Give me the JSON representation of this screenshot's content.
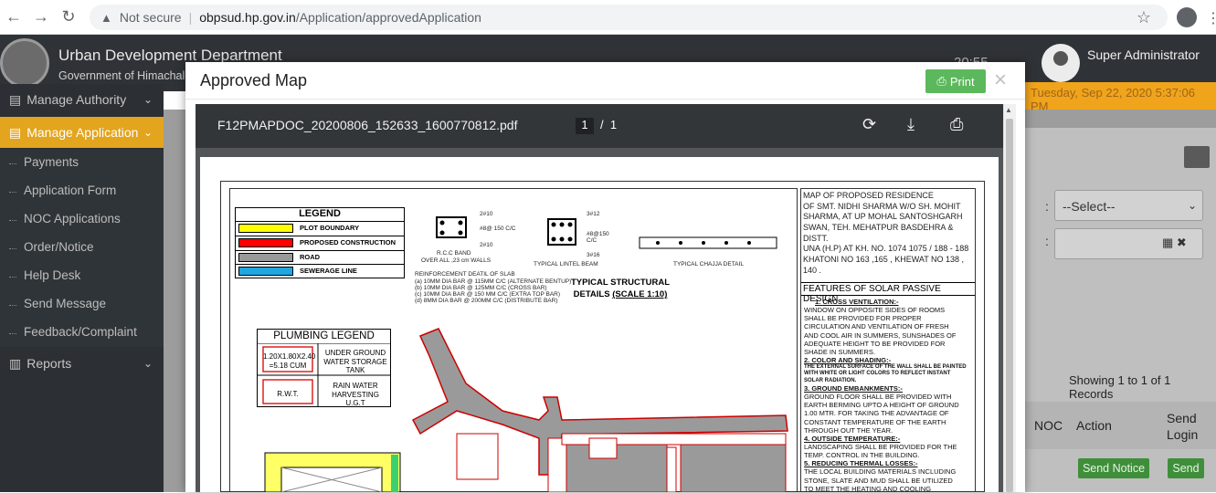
{
  "browser": {
    "security": "Not secure",
    "host": "obpsud.hp.gov.in",
    "path": "/Application/approvedApplication"
  },
  "header": {
    "dept": "Urban Development Department",
    "gov": "Government of Himachal",
    "clock": "20:55",
    "user": "Super Administrator",
    "date": "Tuesday, Sep 22, 2020 5:37:06 PM"
  },
  "sidebar": {
    "items": [
      {
        "label": "Manage Authority"
      },
      {
        "label": "Manage Application"
      },
      {
        "label": "Reports"
      }
    ],
    "sub": [
      {
        "label": "Payments"
      },
      {
        "label": "Application Form"
      },
      {
        "label": "NOC Applications"
      },
      {
        "label": "Order/Notice"
      },
      {
        "label": "Help Desk"
      },
      {
        "label": "Send Message"
      },
      {
        "label": "Feedback/Complaint"
      }
    ]
  },
  "filters": {
    "select_value": "--Select--",
    "showing": "Showing 1 to 1 of 1 Records"
  },
  "table": {
    "cols": [
      "NOC",
      "Action",
      "Send Login"
    ],
    "send_notice": "Send Notice",
    "send": "Send"
  },
  "modal": {
    "title": "Approved Map",
    "print": "Print",
    "close": "×"
  },
  "pdf": {
    "filename": "F12PMAPDOC_20200806_152633_1600770812.pdf",
    "page": "1",
    "total": "1"
  },
  "drawing": {
    "legend_title": "LEGEND",
    "legend": [
      {
        "label": "PLOT BOUNDARY",
        "color": "#ffff00"
      },
      {
        "label": "PROPOSED CONSTRUCTION",
        "color": "#ff0000"
      },
      {
        "label": "ROAD",
        "color": "#999999"
      },
      {
        "label": "SEWERAGE LINE",
        "color": "#1ea7e0"
      }
    ],
    "bar_10a": "2#10",
    "bar_8_150": "#8@ 150 C/C",
    "bar_10b": "2#10",
    "rcc_band": "R.C.C BAND",
    "all_walls": "OVER ALL ,23 cm WALLS",
    "bar_12": "3#12",
    "bar_8_150b": "#8@150 C/C",
    "bar_16": "3#16",
    "lintel": "TYPICAL LINTEL BEAM",
    "chajja": "TYPICAL CHAJJA DETAIL",
    "slab_title": "REINFORCEMENT DEATIL OF SLAB",
    "slab_a": "(a) 10MM DIA BAR @ 115MM C/C (ALTERNATE BENTUP)",
    "slab_b": "(b) 10MM DIA BAR @ 125MM C/C (CROSS BAR)",
    "slab_c": "(c) 10MM DIA BAR @ 150 MM C/C (EXTRA TOP BAR)",
    "slab_d": "(d) 8MM DIA BAR @ 200MM C/C (DISTRIBUTE BAR)",
    "struct_1": "TYPICAL STRUCTURAL",
    "struct_2": "DETAILS",
    "struct_scale": "(SCALE 1:10)",
    "plumb_title": "PLUMBING LEGEND",
    "tank_size_1": "1.20X1.80X2.40",
    "tank_size_2": "=5.18 CUM",
    "tank_label_1": "UNDER GROUND",
    "tank_label_2": "WATER STORAGE",
    "tank_label_3": "TANK",
    "rwt": "R.W.T.",
    "rain_1": "RAIN WATER",
    "rain_2": "HARVESTING",
    "rain_3": "U.G.T",
    "map_1": "MAP OF PROPOSED RESIDENCE",
    "map_2": "OF SMT. NIDHI SHARMA W/O SH. MOHIT",
    "map_3": "SHARMA, AT UP MOHAL SANTOSHGARH",
    "map_4": "SWAN, TEH. MEHATPUR BASDEHRA &",
    "map_5": "DISTT.",
    "map_6": "UNA (H.P)  AT KH. NO. 1074 1075 / 188 - 188",
    "map_7": "KHATONI NO 163 ,165 , KHEWAT NO 138 ,",
    "map_8": "140 .",
    "features_title": "FEATURES OF SOLAR PASSIVE DESIGN",
    "f1_title": "1.    CROSS VENTILATION:-",
    "f1_1": "WINDOW ON OPPOSITE SIDES OF ROOMS",
    "f1_2": "SHALL BE PROVIDED FOR PROPER",
    "f1_3": "CIRCULATION AND VENTILATION OF FRESH",
    "f1_4": "AND COOL AIR IN SUMMERS, SUNSHADES OF",
    "f1_5": "ADEQUATE HEIGHT TO BE PROVIDED FOR",
    "f1_6": "SHADE IN SUMMERS.",
    "f2_title": "2. COLOR AND SHADING:-",
    "f2_1": "THE EXTERNAL SURFACE OF THE WALL SHALL BE PAINTED",
    "f2_2": "WITH WHITE OR LIGHT COLORS TO REFLECT INSTANT",
    "f2_3": "SOLAR RADIATION.",
    "f3_title": "3. GROUND EMBANKMENTS:-",
    "f3_1": "GROUND FLOOR SHALL BE PROVIDED WITH",
    "f3_2": "EARTH BERMING UPTO A HEIGHT OF GROUND",
    "f3_3": "1.00 MTR. FOR TAKING THE ADVANTAGE OF",
    "f3_4": "CONSTANT TEMPERATURE OF THE EARTH",
    "f3_5": "THROUGH OUT THE YEAR.",
    "f4_title": "4. OUTSIDE TEMPERATURE:-",
    "f4_1": "LANDSCAPING SHALL BE PROVIDED FOR THE",
    "f4_2": "TEMP. CONTROL IN THE BUILDING.",
    "f5_title": "5. REDUCING THERMAL LOSSES:-",
    "f5_1": "THE LOCAL BUILDING MATERIALS INCLUDING",
    "f5_2": "STONE, SLATE AND MUD SHALL BE UTILIZED",
    "f5_3": "TO MEET THE HEATING AND COOLING"
  }
}
